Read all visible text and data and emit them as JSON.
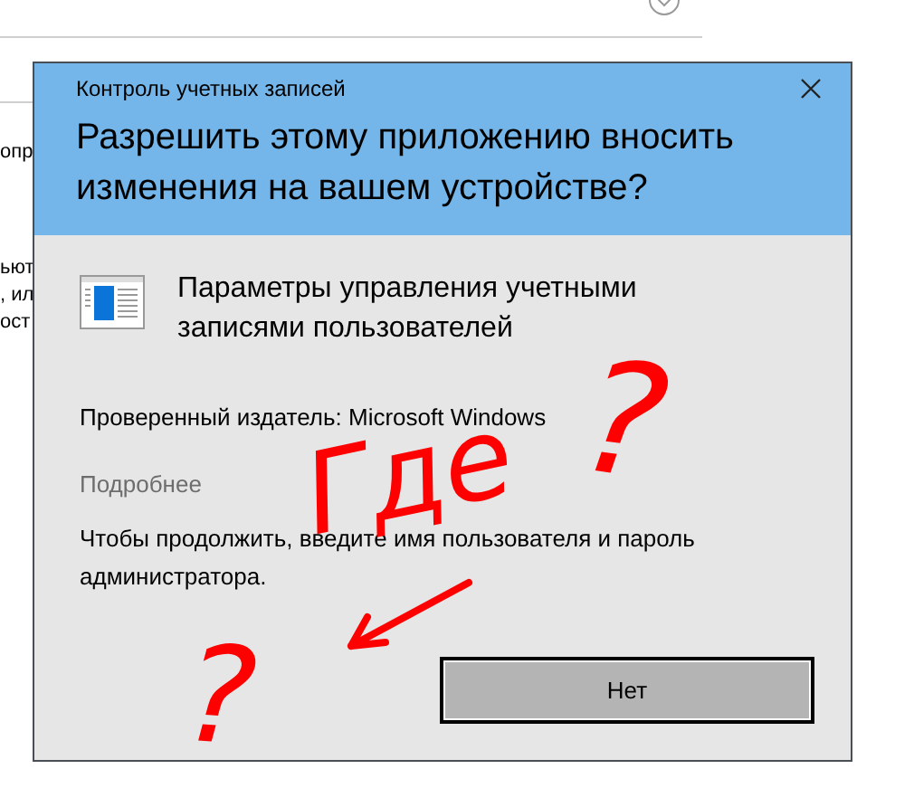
{
  "background": {
    "fragments": [
      "опр",
      "ьют",
      ", ил",
      "ост"
    ]
  },
  "dialog": {
    "title": "Контроль учетных записей",
    "heading": "Разрешить этому приложению вносить изменения на вашем устройстве?",
    "app_name": "Параметры управления учетными записями пользователей",
    "publisher": "Проверенный издатель: Microsoft Windows",
    "details_link": "Подробнее",
    "message": "Чтобы продолжить, введите имя пользователя и пароль администратора.",
    "buttons": [
      {
        "label": "Нет",
        "focused": true
      }
    ]
  },
  "annotations": [
    {
      "kind": "text",
      "text": "Где"
    },
    {
      "kind": "text",
      "text": "?"
    },
    {
      "kind": "text",
      "text": "?"
    },
    {
      "kind": "arrow"
    }
  ]
}
